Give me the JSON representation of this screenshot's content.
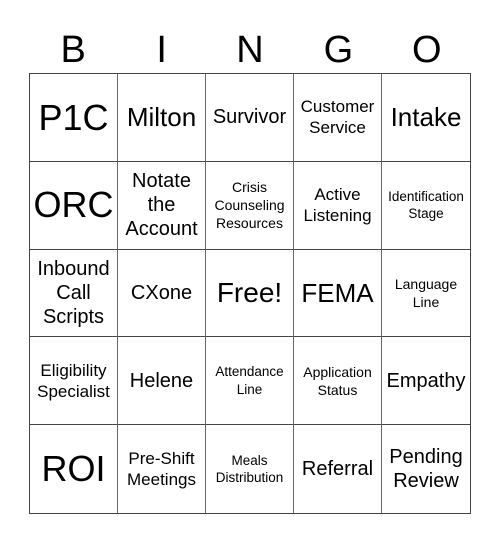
{
  "header": [
    "B",
    "I",
    "N",
    "G",
    "O"
  ],
  "cells": [
    "P1C",
    "Milton",
    "Survivor",
    "Customer Service",
    "Intake",
    "ORC",
    "Notate the Account",
    "Crisis Counseling Resources",
    "Active Listening",
    "Identification Stage",
    "Inbound Call Scripts",
    "CXone",
    "Free!",
    "FEMA",
    "Language Line",
    "Eligibility Specialist",
    "Helene",
    "Attendance Line",
    "Application Status",
    "Empathy",
    "ROI",
    "Pre-Shift Meetings",
    "Meals Distribution",
    "Referral",
    "Pending Review"
  ]
}
